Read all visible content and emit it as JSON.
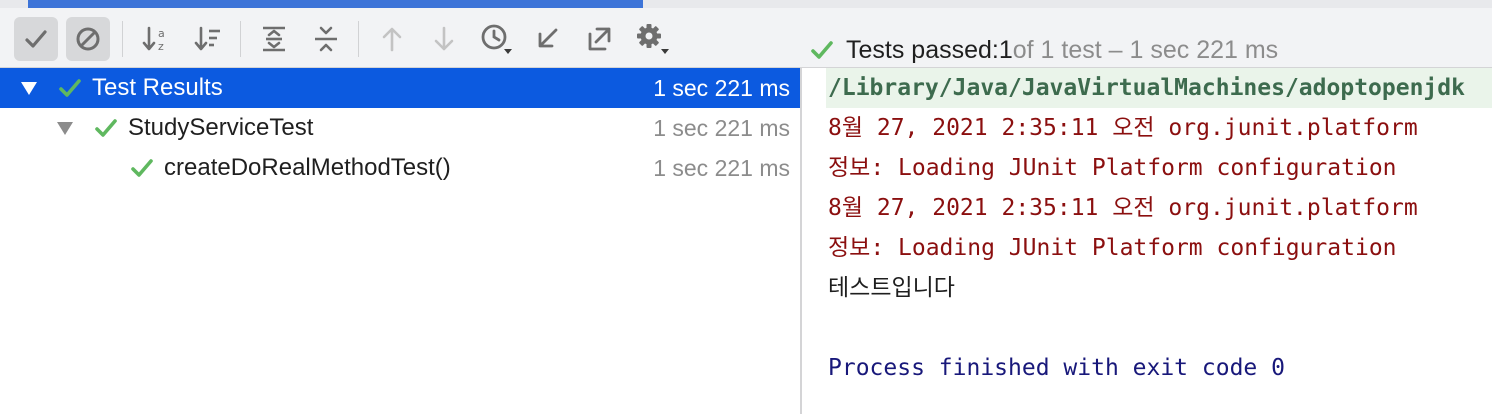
{
  "progress": {
    "fraction": 0.42
  },
  "toolbar": {
    "buttons": [
      {
        "icon": "show-passed-icon",
        "active": true
      },
      {
        "icon": "show-ignored-icon",
        "active": true
      },
      {
        "icon": "sort-alphabetically-icon"
      },
      {
        "icon": "sort-by-duration-icon"
      },
      {
        "icon": "expand-all-icon"
      },
      {
        "icon": "collapse-all-icon"
      },
      {
        "icon": "previous-failed-icon"
      },
      {
        "icon": "next-failed-icon"
      },
      {
        "icon": "history-icon"
      },
      {
        "icon": "import-tests-icon"
      },
      {
        "icon": "export-tests-icon"
      },
      {
        "icon": "settings-icon"
      }
    ]
  },
  "status": {
    "prefix": "Tests passed: ",
    "count": "1",
    "suffix": " of 1 test – 1 sec 221 ms"
  },
  "tree": {
    "rows": [
      {
        "label": "Test Results",
        "duration": "1 sec 221 ms",
        "selected": true
      },
      {
        "label": "StudyServiceTest",
        "duration": "1 sec 221 ms"
      },
      {
        "label": "createDoRealMethodTest()",
        "duration": "1 sec 221 ms"
      }
    ]
  },
  "console": {
    "lines": [
      "/Library/Java/JavaVirtualMachines/adoptopenjdk",
      "8월 27, 2021 2:35:11 오전 org.junit.platform",
      "정보: Loading JUnit Platform configuration",
      "8월 27, 2021 2:35:11 오전 org.junit.platform",
      "정보: Loading JUnit Platform configuration",
      "테스트입니다",
      "Process finished with exit code 0"
    ]
  },
  "colors": {
    "accent": "#0c5ae0",
    "pass": "#5fb85f",
    "log": "#8b0f0f",
    "exit": "#18187a"
  }
}
